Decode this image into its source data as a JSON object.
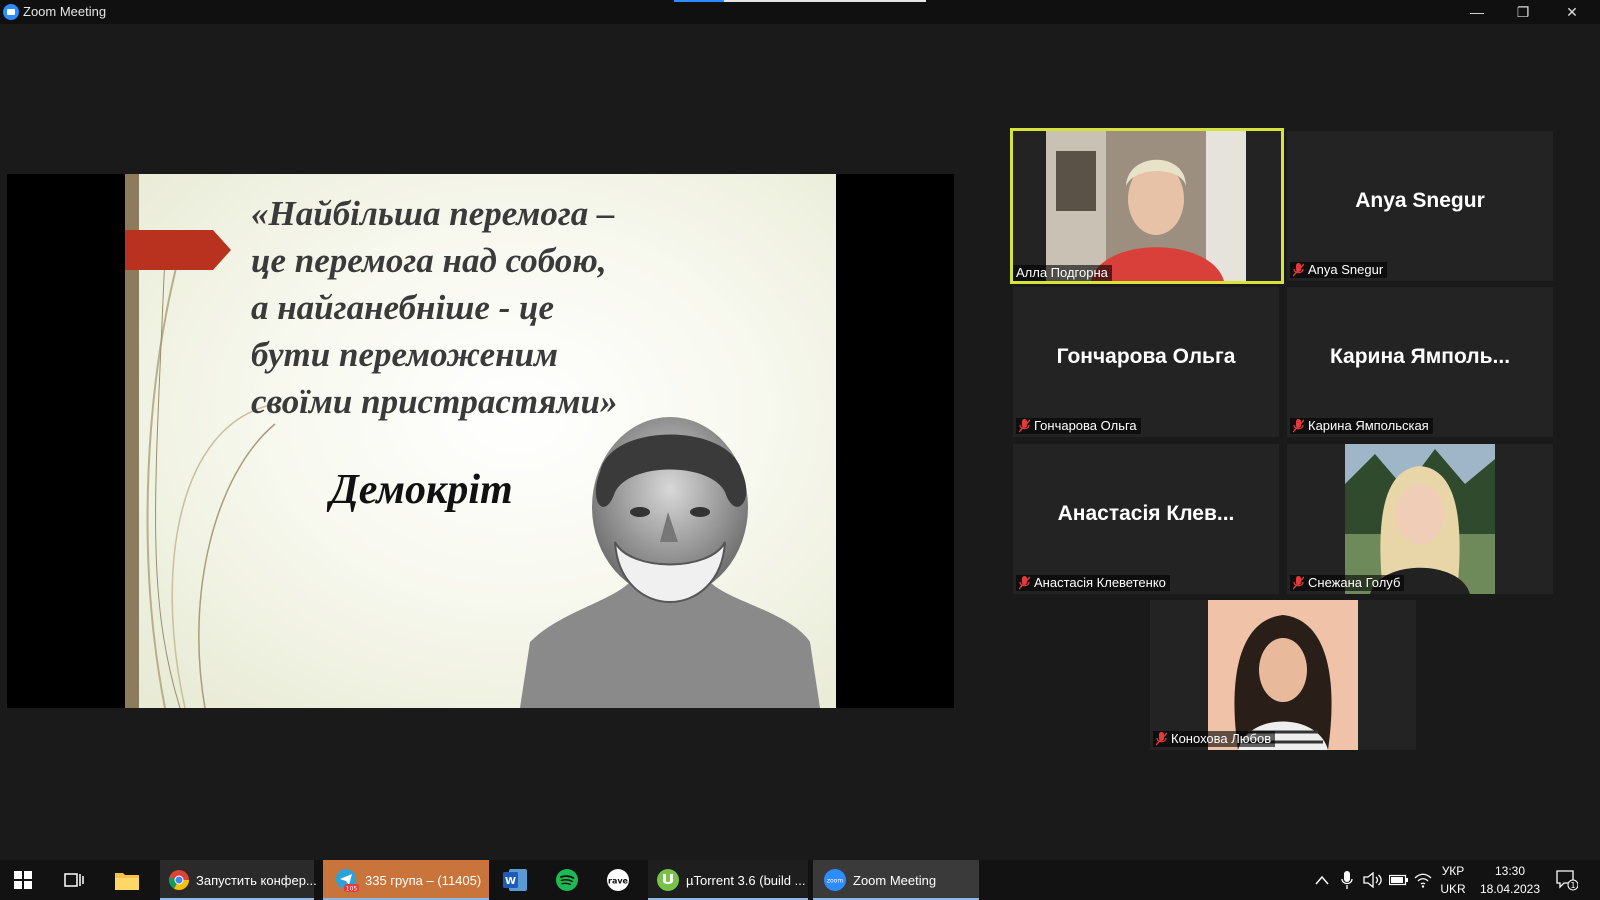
{
  "window": {
    "title": "Zoom Meeting"
  },
  "slide": {
    "quote_lines": [
      "«Найбільша перемога –",
      "це перемога над собою,",
      "а найганебніше - це",
      "бути переможеним",
      "своїми пристрастями»"
    ],
    "author": "Демокріт"
  },
  "participants": [
    {
      "name": "Алла Подгорна",
      "big_name": "",
      "video": true,
      "muted": false,
      "active": true
    },
    {
      "name": "Anya Snegur",
      "big_name": "Anya Snegur",
      "video": false,
      "muted": true,
      "active": false
    },
    {
      "name": "Гончарова Ольга",
      "big_name": "Гончарова Ольга",
      "video": false,
      "muted": true,
      "active": false
    },
    {
      "name": "Карина Ямпольская",
      "big_name": "Карина Ямполь...",
      "video": false,
      "muted": true,
      "active": false
    },
    {
      "name": "Анастасія Клеветенко",
      "big_name": "Анастасія Клев...",
      "video": false,
      "muted": true,
      "active": false
    },
    {
      "name": "Снежана Голуб",
      "big_name": "",
      "video": true,
      "muted": true,
      "active": false
    },
    {
      "name": "Конохова Любов",
      "big_name": "",
      "video": true,
      "muted": true,
      "active": false
    }
  ],
  "taskbar": {
    "apps": [
      {
        "label": "Запустить конфер...",
        "icon": "chrome-icon"
      },
      {
        "label": "335 група – (11405)",
        "icon": "telegram-icon",
        "badge": "105"
      },
      {
        "label": "",
        "icon": "word-icon"
      },
      {
        "label": "",
        "icon": "spotify-icon"
      },
      {
        "label": "",
        "icon": "rave-icon"
      },
      {
        "label": "µTorrent 3.6  (build ...",
        "icon": "utorrent-icon"
      },
      {
        "label": "Zoom Meeting",
        "icon": "zoom-icon"
      }
    ],
    "tray": {
      "lang_top": "УКР",
      "lang_bottom": "UKR",
      "time": "13:30",
      "date": "18.04.2023",
      "notifications": "1"
    }
  },
  "colors": {
    "active_speaker": "#d6e33c",
    "muted_red": "#e23b3b",
    "zoom_blue": "#2d8cff",
    "telegram_bg": "#c9743a"
  }
}
